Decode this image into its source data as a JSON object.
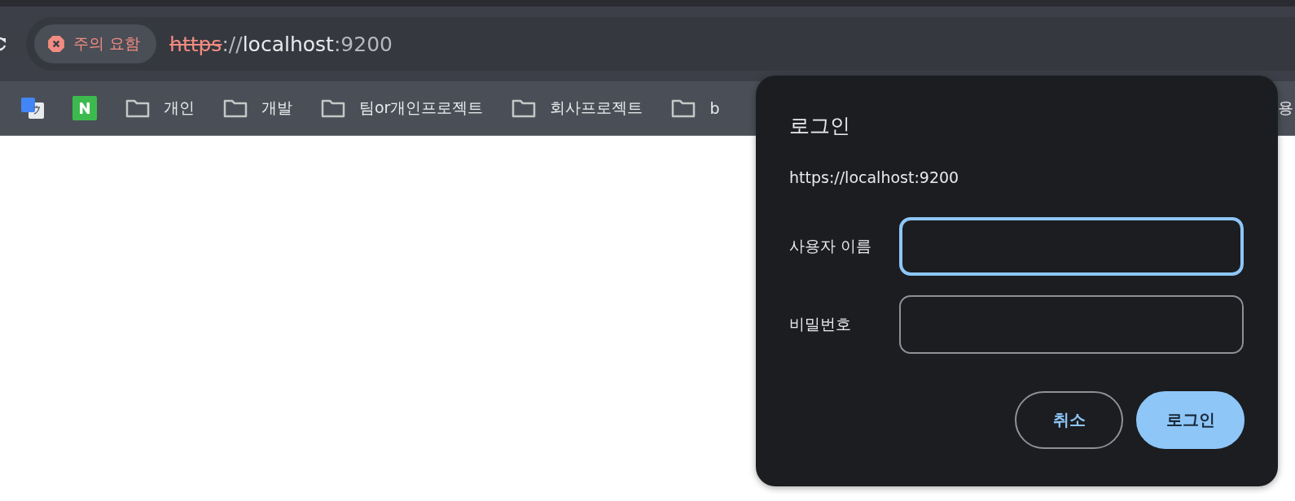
{
  "address_bar": {
    "security_chip": "주의 요함",
    "scheme": "https",
    "separator": "://",
    "host": "localhost",
    "port": ":9200"
  },
  "bookmarks": [
    {
      "kind": "translate"
    },
    {
      "kind": "naver"
    },
    {
      "kind": "folder",
      "label": "개인"
    },
    {
      "kind": "folder",
      "label": "개발"
    },
    {
      "kind": "folder",
      "label": "팀or개인프로젝트"
    },
    {
      "kind": "folder",
      "label": "회사프로젝트"
    },
    {
      "kind": "folder",
      "label": "b"
    }
  ],
  "bookmark_edge": {
    "label": "용"
  },
  "login_dialog": {
    "title": "로그인",
    "origin": "https://localhost:9200",
    "fields": [
      {
        "label": "사용자 이름",
        "focused": true
      },
      {
        "label": "비밀번호",
        "focused": false
      }
    ],
    "buttons": [
      {
        "label": "취소",
        "kind": "secondary"
      },
      {
        "label": "로그인",
        "kind": "primary"
      }
    ]
  }
}
